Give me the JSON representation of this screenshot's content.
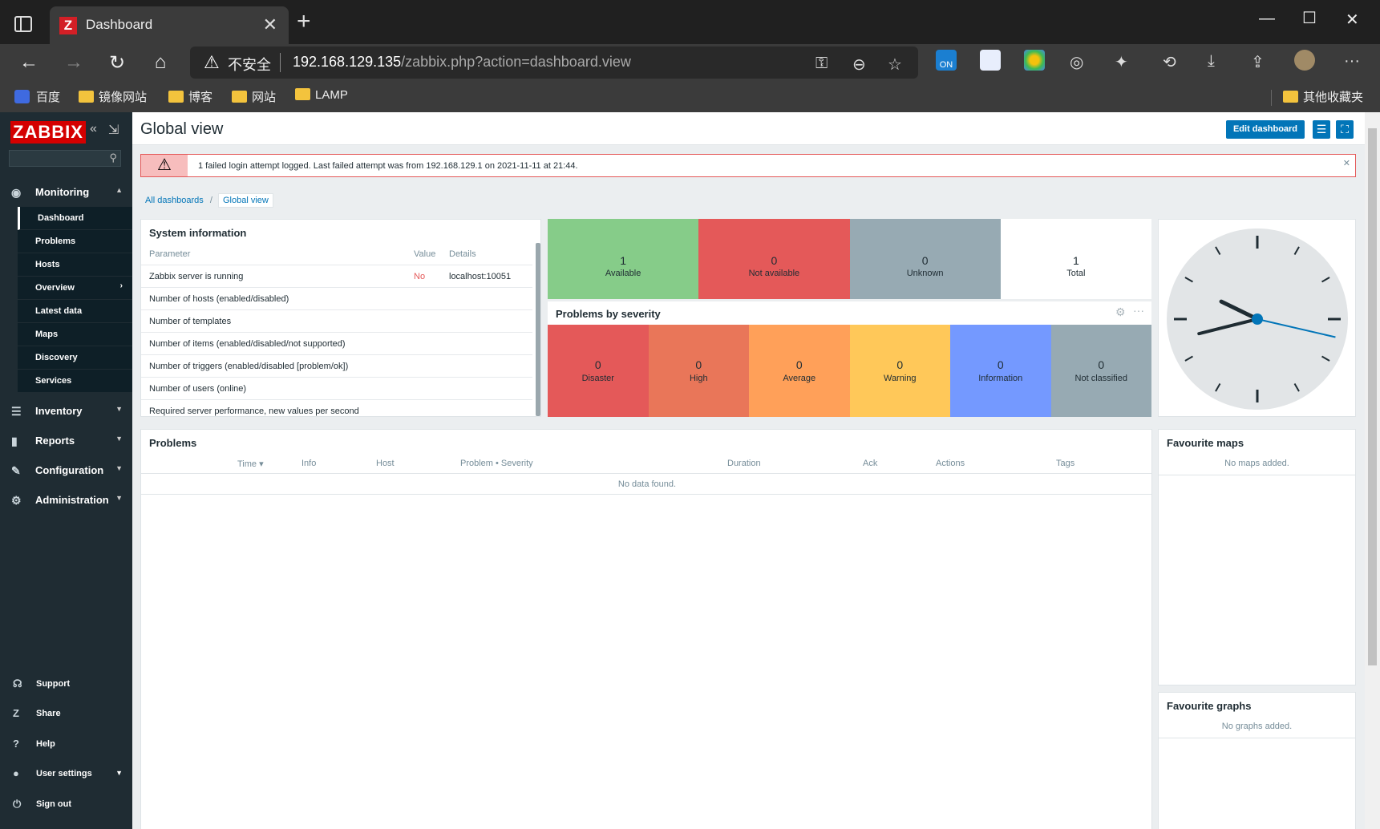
{
  "browser": {
    "tab_title": "Dashboard",
    "tab_favicon": "Z",
    "insecure_label": "不安全",
    "url_host": "192.168.129.135",
    "url_path": "/zabbix.php?action=dashboard.view",
    "ext_on_label": "ON",
    "bookmarks": [
      "百度",
      "镜像网站",
      "博客",
      "网站",
      "LAMP"
    ],
    "other_bookmarks": "其他收藏夹"
  },
  "sidebar": {
    "logo": "ZABBIX",
    "menu": {
      "monitoring": "Monitoring",
      "inventory": "Inventory",
      "reports": "Reports",
      "configuration": "Configuration",
      "administration": "Administration"
    },
    "monitoring_items": [
      "Dashboard",
      "Problems",
      "Hosts",
      "Overview",
      "Latest data",
      "Maps",
      "Discovery",
      "Services"
    ],
    "bottom": {
      "support": "Support",
      "share": "Share",
      "help": "Help",
      "user_settings": "User settings",
      "sign_out": "Sign out"
    }
  },
  "header": {
    "title": "Global view",
    "edit_button": "Edit dashboard"
  },
  "alert": {
    "message": "1 failed login attempt logged. Last failed attempt was from 192.168.129.1 on 2021-11-11 at 21:44."
  },
  "breadcrumb": {
    "all": "All dashboards",
    "sep": "/",
    "current": "Global view"
  },
  "system_info": {
    "title": "System information",
    "columns": [
      "Parameter",
      "Value",
      "Details"
    ],
    "rows": [
      {
        "parameter": "Zabbix server is running",
        "value": "No",
        "details": "localhost:10051"
      },
      {
        "parameter": "Number of hosts (enabled/disabled)",
        "value": "",
        "details": ""
      },
      {
        "parameter": "Number of templates",
        "value": "",
        "details": ""
      },
      {
        "parameter": "Number of items (enabled/disabled/not supported)",
        "value": "",
        "details": ""
      },
      {
        "parameter": "Number of triggers (enabled/disabled [problem/ok])",
        "value": "",
        "details": ""
      },
      {
        "parameter": "Number of users (online)",
        "value": "",
        "details": ""
      },
      {
        "parameter": "Required server performance, new values per second",
        "value": "",
        "details": ""
      }
    ],
    "value_no_color": "#e45959"
  },
  "host_availability": [
    {
      "count": "1",
      "label": "Available",
      "color": "#86cc89"
    },
    {
      "count": "0",
      "label": "Not available",
      "color": "#e45959"
    },
    {
      "count": "0",
      "label": "Unknown",
      "color": "#97aab3"
    },
    {
      "count": "1",
      "label": "Total",
      "color": "#ffffff"
    }
  ],
  "problems_by_severity": {
    "title": "Problems by severity",
    "items": [
      {
        "count": "0",
        "label": "Disaster",
        "color": "#e45959"
      },
      {
        "count": "0",
        "label": "High",
        "color": "#e97659"
      },
      {
        "count": "0",
        "label": "Average",
        "color": "#ffa059"
      },
      {
        "count": "0",
        "label": "Warning",
        "color": "#ffc859"
      },
      {
        "count": "0",
        "label": "Information",
        "color": "#7499ff"
      },
      {
        "count": "0",
        "label": "Not classified",
        "color": "#97aab3"
      }
    ]
  },
  "problems": {
    "title": "Problems",
    "columns": [
      "Time ▾",
      "Info",
      "Host",
      "Problem • Severity",
      "Duration",
      "Ack",
      "Actions",
      "Tags"
    ],
    "empty": "No data found."
  },
  "favourite_maps": {
    "title": "Favourite maps",
    "empty": "No maps added."
  },
  "favourite_graphs": {
    "title": "Favourite graphs",
    "empty": "No graphs added."
  },
  "clock": {
    "hour_angle": 296,
    "minute_angle": 256,
    "second_angle": 103
  }
}
